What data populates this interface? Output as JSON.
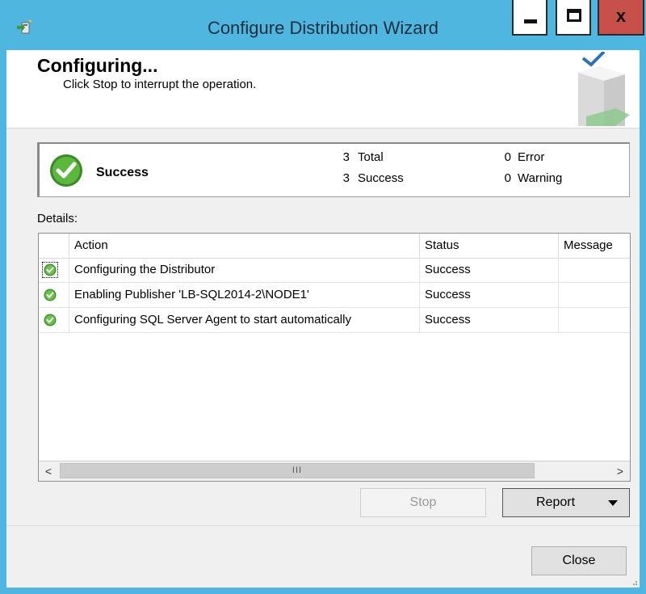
{
  "window": {
    "title": "Configure Distribution Wizard",
    "close_glyph": "x",
    "colors": {
      "titlebar": "#4fb6e0",
      "close_button": "#c7504b"
    },
    "icons": {
      "app": "wizard-app-icon",
      "minimize": "minimize-icon",
      "maximize": "maximize-icon",
      "close": "close-icon"
    }
  },
  "header": {
    "title": "Configuring...",
    "subtitle": "Click Stop to interrupt the operation.",
    "graphic": "server-checkmark-graphic"
  },
  "summary": {
    "status_label": "Success",
    "status_icon": "success-check-icon",
    "total_count": "3",
    "total_label": "Total",
    "success_count": "3",
    "success_label": "Success",
    "error_count": "0",
    "error_label": "Error",
    "warning_count": "0",
    "warning_label": "Warning"
  },
  "details": {
    "label": "Details:",
    "columns": {
      "action": "Action",
      "status": "Status",
      "message": "Message"
    },
    "rows": [
      {
        "icon": "success-check-icon",
        "action": "Configuring the Distributor",
        "status": "Success",
        "message": ""
      },
      {
        "icon": "success-check-icon",
        "action": "Enabling Publisher 'LB-SQL2014-2\\NODE1'",
        "status": "Success",
        "message": ""
      },
      {
        "icon": "success-check-icon",
        "action": "Configuring SQL Server Agent to start automatically",
        "status": "Success",
        "message": ""
      }
    ],
    "scrollbar": {
      "left_glyph": "<",
      "right_glyph": ">",
      "thumb_glyph": "III"
    }
  },
  "buttons": {
    "stop": "Stop",
    "report": "Report",
    "close": "Close"
  }
}
